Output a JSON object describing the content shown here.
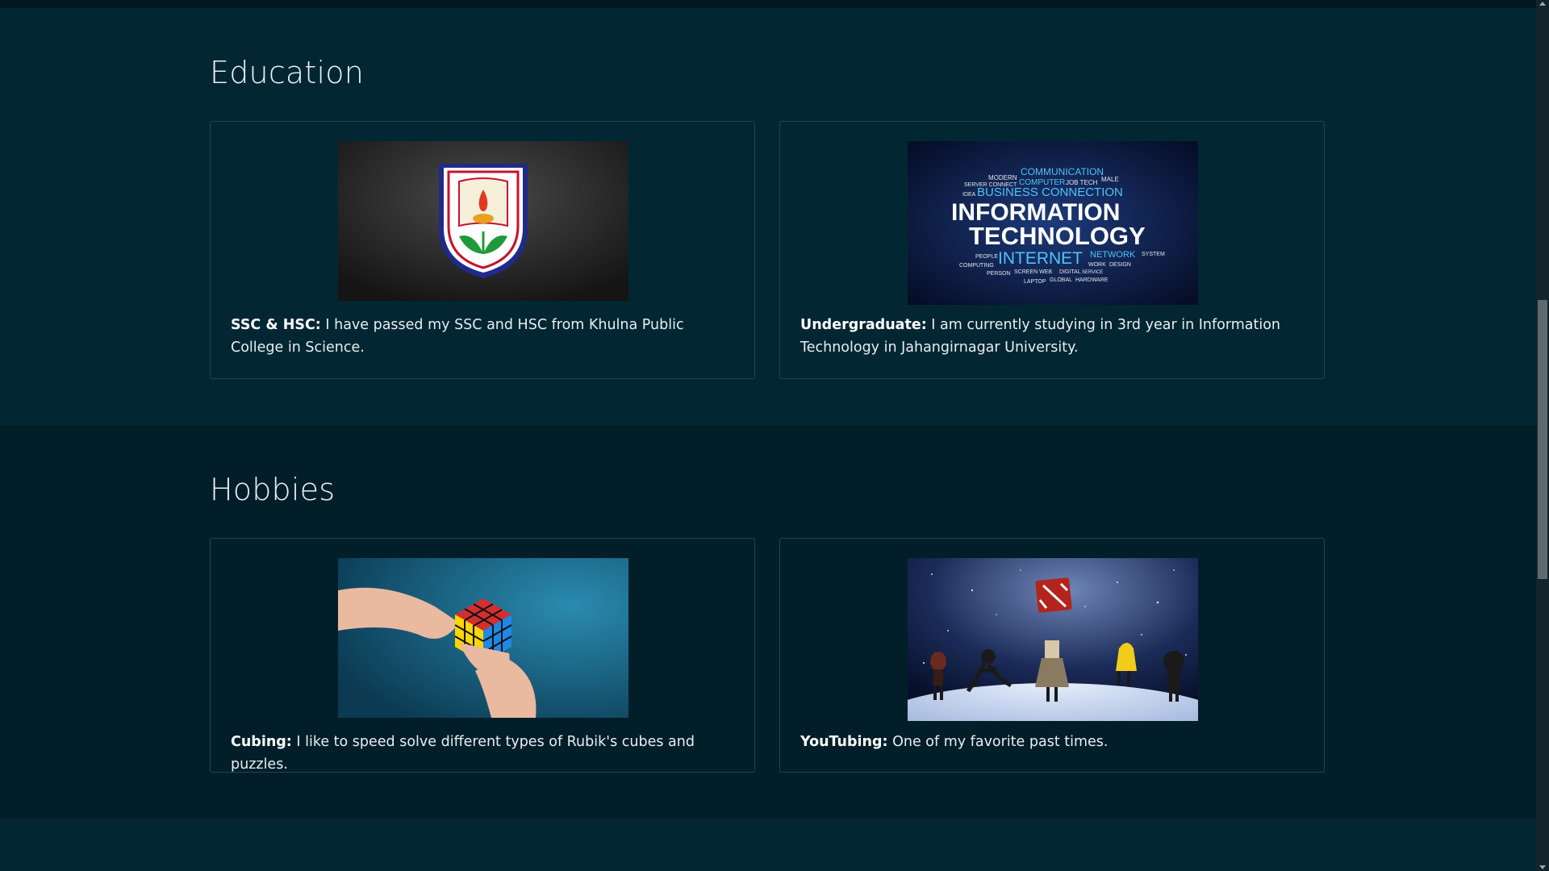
{
  "education": {
    "title": "Education",
    "cards": [
      {
        "image": "khulna-public-college-logo",
        "label": "SSC & HSC:",
        "text": " I have passed my SSC and HSC from Khulna Public College in Science."
      },
      {
        "image": "information-technology-word-cloud",
        "label": "Undergraduate:",
        "text": " I am currently studying in 3rd year in Information Technology in Jahangirnagar University.",
        "image_words": {
          "main1": "INFORMATION",
          "main2": "TECHNOLOGY",
          "internet": "INTERNET",
          "business": "BUSINESS CONNECTION",
          "communication": "COMMUNICATION",
          "computer": "COMPUTER",
          "network": "NETWORK",
          "modern": "MODERN",
          "server": "SERVER CONNECT",
          "job": "JOB TECH",
          "idea": "IDEA",
          "people": "PEOPLE",
          "computing": "COMPUTING",
          "person": "PERSON",
          "screen": "SCREEN WEB",
          "digital": "DIGITAL",
          "service": "SERVICE",
          "laptop": "LAPTOP",
          "global": "GLOBAL",
          "hardware": "HARDWARE",
          "work": "WORK",
          "design": "DESIGN",
          "system": "SYSTEM",
          "male": "MALE"
        }
      }
    ]
  },
  "hobbies": {
    "title": "Hobbies",
    "cards": [
      {
        "image": "rubiks-cube-in-hands",
        "label": "Cubing:",
        "text": " I like to speed solve different types of Rubik's cubes and puzzles."
      },
      {
        "image": "game-characters-in-space",
        "label": "YouTubing:",
        "text": " One of my favorite past times."
      }
    ]
  },
  "colors": {
    "background": "#032633",
    "alt_background": "#021e29",
    "card_border": "#1c4656",
    "text": "#e8eef0"
  }
}
